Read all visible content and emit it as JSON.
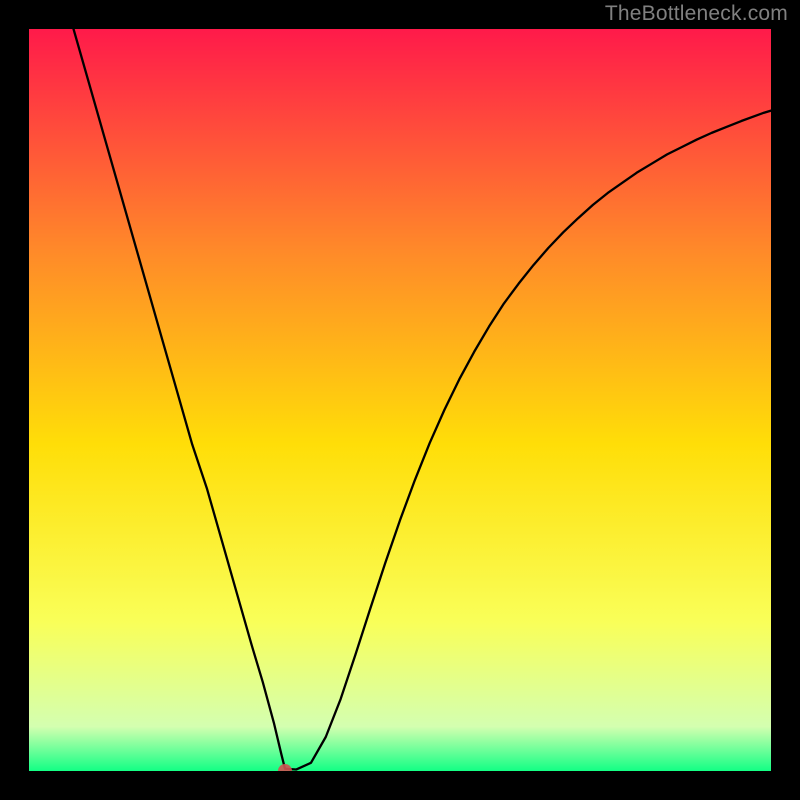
{
  "watermark": "TheBottleneck.com",
  "chart_data": {
    "type": "line",
    "title": "",
    "xlabel": "",
    "ylabel": "",
    "xlim": [
      0,
      100
    ],
    "ylim": [
      0,
      100
    ],
    "grid": false,
    "legend": false,
    "background_gradient": {
      "top_color": "#ff1a4a",
      "mid_upper_color": "#ff8a29",
      "mid_color": "#ffde08",
      "mid_lower_color": "#f9ff59",
      "near_bottom_color": "#d4ffb0",
      "bottom_color": "#13ff85"
    },
    "marker": {
      "x": 34.5,
      "y": 0,
      "color": "#d15252",
      "radius_px": 7
    },
    "curve_samples": {
      "x": [
        6,
        8,
        10,
        12,
        14,
        16,
        18,
        20,
        22,
        24,
        26,
        28,
        30,
        31.5,
        33,
        34,
        34.5,
        36,
        38,
        40,
        42,
        44,
        46,
        48,
        50,
        52,
        54,
        56,
        58,
        60,
        62,
        64,
        66,
        68,
        70,
        72,
        74,
        76,
        78,
        80,
        82,
        84,
        86,
        88,
        90,
        92,
        94,
        96,
        99,
        100
      ],
      "y": [
        100,
        93,
        86,
        79,
        72,
        65,
        58,
        51,
        44,
        38,
        31,
        24,
        17,
        12,
        6.5,
        2.3,
        0.3,
        0.2,
        1.1,
        4.6,
        9.7,
        15.7,
        21.9,
        28,
        33.8,
        39.2,
        44.2,
        48.7,
        52.8,
        56.5,
        59.9,
        63,
        65.7,
        68.2,
        70.5,
        72.6,
        74.5,
        76.3,
        77.9,
        79.3,
        80.7,
        81.9,
        83.1,
        84.1,
        85.1,
        86,
        86.8,
        87.6,
        88.7,
        89
      ]
    },
    "plateau": {
      "x0": 32.5,
      "x1": 36.2,
      "y": 0.2
    }
  }
}
